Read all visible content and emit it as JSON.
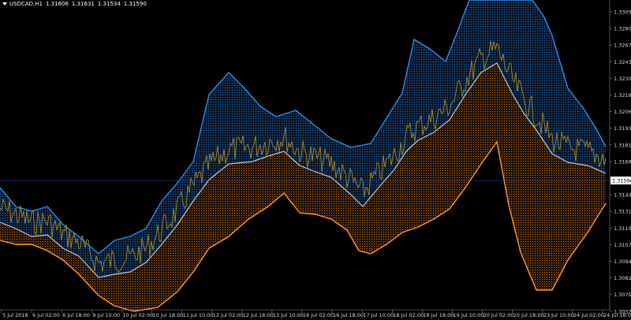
{
  "header": {
    "symbol": "USDCAD,H1",
    "open": "1.31606",
    "high": "1.31631",
    "low": "1.31534",
    "close": "1.31590"
  },
  "current_price": "1.31590",
  "colors": {
    "background": "#000000",
    "upper_band": "#2f8ce8",
    "upper_fill": "#1f6fc8",
    "middle_band": "#c8c8c8",
    "lower_band": "#ff9a35",
    "lower_fill": "#e67e22",
    "price_line": "#b5962c",
    "grid_h_line": "#2b42c8",
    "axis": "#8a8a8a"
  },
  "price_axis": [
    "1.33050",
    "1.32800",
    "1.32675",
    "1.32430",
    "1.32305",
    "1.32180",
    "1.32060",
    "1.31935",
    "1.31810",
    "1.31690",
    "1.31565",
    "1.31440",
    "1.31315",
    "1.31195",
    "1.31070",
    "1.30945",
    "1.30825",
    "1.30700",
    "1.30575"
  ],
  "time_axis": [
    "5 Jul 2018",
    "6 Jul 02:00",
    "6 Jul 18:00",
    "9 Jul 10:00",
    "10 Jul 02:00",
    "10 Jul 18:00",
    "11 Jul 10:00",
    "12 Jul 02:00",
    "12 Jul 18:00",
    "13 Jul 10:00",
    "16 Jul 02:00",
    "16 Jul 18:00",
    "17 Jul 10:00",
    "18 Jul 02:00",
    "18 Jul 18:00",
    "19 Jul 10:00",
    "20 Jul 02:00",
    "20 Jul 18:00",
    "23 Jul 10:00",
    "24 Jul 02:00",
    "24 Jul 18:00"
  ]
}
